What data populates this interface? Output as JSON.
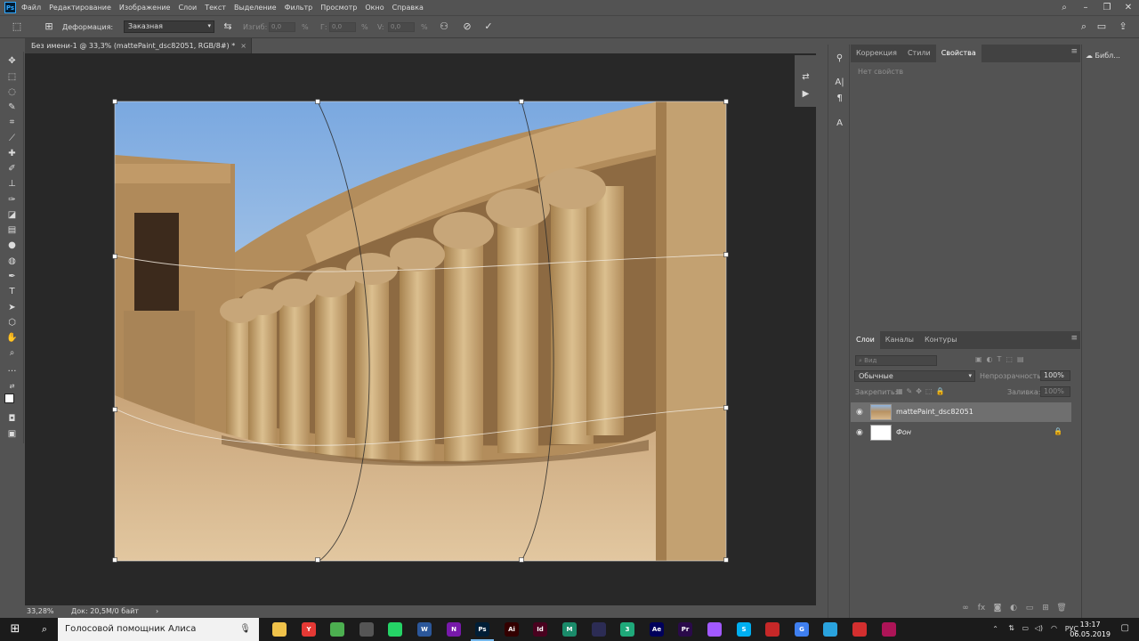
{
  "menu": {
    "items": [
      "Файл",
      "Редактирование",
      "Изображение",
      "Слои",
      "Текст",
      "Выделение",
      "Фильтр",
      "Просмотр",
      "Окно",
      "Справка"
    ]
  },
  "options": {
    "deform_label": "Деформация:",
    "deform_value": "Заказная",
    "bend_label": "Изгиб:",
    "bend_value": "0,0",
    "h_label": "Г:",
    "h_value": "0,0",
    "v_label": "V:",
    "v_value": "0,0",
    "percent": "%"
  },
  "document": {
    "tab_title": "Без имени-1 @ 33,3% (mattePaint_dsc82051, RGB/8#) *",
    "close": "×"
  },
  "status": {
    "zoom": "33,28%",
    "doc_info": "Док: 20,5M/0 байт",
    "arrow": "›"
  },
  "properties": {
    "tabs": [
      "Коррекция",
      "Стили",
      "Свойства"
    ],
    "active_tab": 2,
    "empty_text": "Нет свойств"
  },
  "layers": {
    "tabs": [
      "Слои",
      "Каналы",
      "Контуры"
    ],
    "filter_placeholder": "Вид",
    "blend_mode": "Обычные",
    "opacity_label": "Непрозрачность:",
    "opacity_value": "100%",
    "lock_label": "Закрепить:",
    "fill_label": "Заливка:",
    "fill_value": "100%",
    "items": [
      {
        "name": "mattePaint_dsc82051",
        "selected": true,
        "locked": false
      },
      {
        "name": "Фон",
        "selected": false,
        "locked": true
      }
    ]
  },
  "right_dock": {
    "libraries": "Библ..."
  },
  "taskbar": {
    "assistant": "Голосовой помощник Алиса",
    "lang": "РУС",
    "time": "13:17",
    "date": "06.05.2019",
    "apps": [
      {
        "name": "file-explorer",
        "label": "",
        "color": "#f0c24a"
      },
      {
        "name": "yandex-browser",
        "label": "Y",
        "color": "#e53935"
      },
      {
        "name": "chrome",
        "label": "",
        "color": "#4caf50"
      },
      {
        "name": "mail",
        "label": "",
        "color": "#555555"
      },
      {
        "name": "whatsapp",
        "label": "",
        "color": "#25d366"
      },
      {
        "name": "word",
        "label": "W",
        "color": "#2b579a"
      },
      {
        "name": "onenote",
        "label": "N",
        "color": "#7719aa"
      },
      {
        "name": "photoshop",
        "label": "Ps",
        "color": "#001e36",
        "active": true
      },
      {
        "name": "illustrator",
        "label": "Ai",
        "color": "#330000"
      },
      {
        "name": "indesign",
        "label": "Id",
        "color": "#49021f"
      },
      {
        "name": "muse",
        "label": "M",
        "color": "#1a8b6a"
      },
      {
        "name": "obs",
        "label": "",
        "color": "#2c2c54"
      },
      {
        "name": "app-3",
        "label": "3",
        "color": "#1fa97a"
      },
      {
        "name": "after-effects",
        "label": "Ae",
        "color": "#00005b"
      },
      {
        "name": "premiere",
        "label": "Pr",
        "color": "#2a0a4a"
      },
      {
        "name": "figma",
        "label": "",
        "color": "#a259ff"
      },
      {
        "name": "skype",
        "label": "S",
        "color": "#00aff0"
      },
      {
        "name": "app-red",
        "label": "",
        "color": "#c62828"
      },
      {
        "name": "app-g",
        "label": "G",
        "color": "#3f7ff0"
      },
      {
        "name": "telegram",
        "label": "",
        "color": "#2aa3de"
      },
      {
        "name": "app-record",
        "label": "",
        "color": "#d32f2f"
      },
      {
        "name": "app-last",
        "label": "",
        "color": "#ad1457"
      }
    ]
  },
  "colors": {
    "ps_bg": "#535353",
    "canvas_bg": "#282828",
    "taskbar": "#1b1b1b",
    "sky": "#8db9e8",
    "sand": "#d9b88f"
  }
}
